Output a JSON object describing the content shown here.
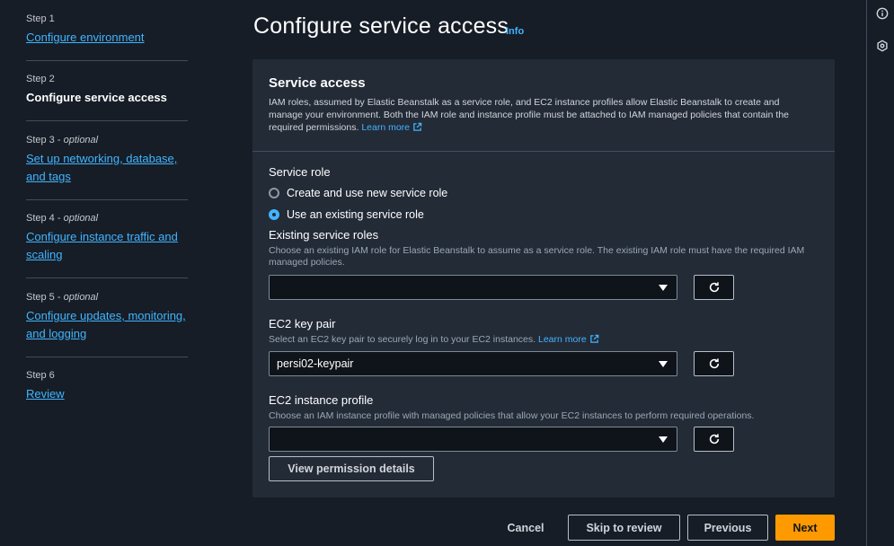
{
  "nav": {
    "steps": [
      {
        "label": "Step 1",
        "optional": "",
        "title": "Configure environment",
        "current": false
      },
      {
        "label": "Step 2",
        "optional": "",
        "title": "Configure service access",
        "current": true
      },
      {
        "label": "Step 3 - ",
        "optional": "optional",
        "title": "Set up networking, database,",
        "title2": "and tags",
        "current": false
      },
      {
        "label": "Step 4 - ",
        "optional": "optional",
        "title": "Configure instance traffic and",
        "title2": "scaling",
        "current": false
      },
      {
        "label": "Step 5 - ",
        "optional": "optional",
        "title": "Configure updates, monitoring,",
        "title2": "and logging",
        "current": false
      },
      {
        "label": "Step 6",
        "optional": "",
        "title": "Review",
        "current": false
      }
    ]
  },
  "header": {
    "title": "Configure service access",
    "info": "Info"
  },
  "panel": {
    "title": "Service access",
    "description": "IAM roles, assumed by Elastic Beanstalk as a service role, and EC2 instance profiles allow Elastic Beanstalk to create and manage your environment. Both the IAM role and instance profile must be attached to IAM managed policies that contain the required permissions.",
    "learn_more": "Learn more",
    "service_role": {
      "label": "Service role",
      "options": [
        "Create and use new service role",
        "Use an existing service role"
      ],
      "selected": 1
    },
    "existing_roles": {
      "label": "Existing service roles",
      "description": "Choose an existing IAM role for Elastic Beanstalk to assume as a service role. The existing IAM role must have the required IAM managed policies.",
      "value": ""
    },
    "key_pair": {
      "label": "EC2 key pair",
      "description": "Select an EC2 key pair to securely log in to your EC2 instances.",
      "learn_more": "Learn more",
      "value": "persi02-keypair"
    },
    "instance_profile": {
      "label": "EC2 instance profile",
      "description": "Choose an IAM instance profile with managed policies that allow your EC2 instances to perform required operations.",
      "value": ""
    },
    "view_permissions": "View permission details"
  },
  "footer": {
    "cancel": "Cancel",
    "skip": "Skip to review",
    "previous": "Previous",
    "next": "Next"
  },
  "colors": {
    "accent": "#42b4ff",
    "primary_button": "#ff9900",
    "background": "#161d26",
    "panel": "#232b37"
  }
}
